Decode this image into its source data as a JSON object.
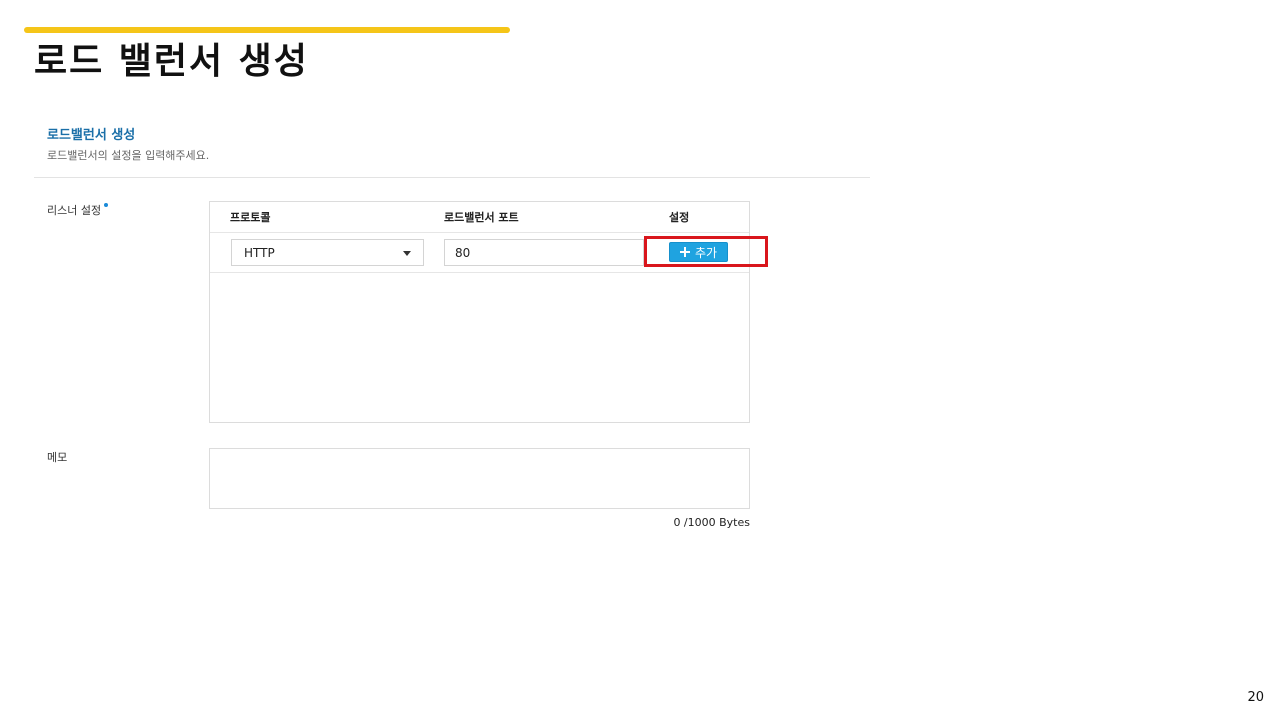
{
  "slide": {
    "title": "로드 밸런서 생성",
    "page_number": "20"
  },
  "section": {
    "title": "로드밸런서 생성",
    "description": "로드밸런서의 설정을 입력해주세요."
  },
  "listener": {
    "label": "리스너 설정",
    "required": true,
    "columns": {
      "protocol": "프로토콜",
      "port": "로드밸런서 포트",
      "settings": "설정"
    },
    "row": {
      "protocol_value": "HTTP",
      "port_value": "80"
    },
    "add_button_label": "추가"
  },
  "memo": {
    "label": "메모",
    "value": "",
    "counter": "0 /1000 Bytes"
  },
  "colors": {
    "accent": "#f5c518",
    "section_title": "#1a6fa8",
    "button": "#1fa3e0",
    "highlight": "#d9161c"
  }
}
